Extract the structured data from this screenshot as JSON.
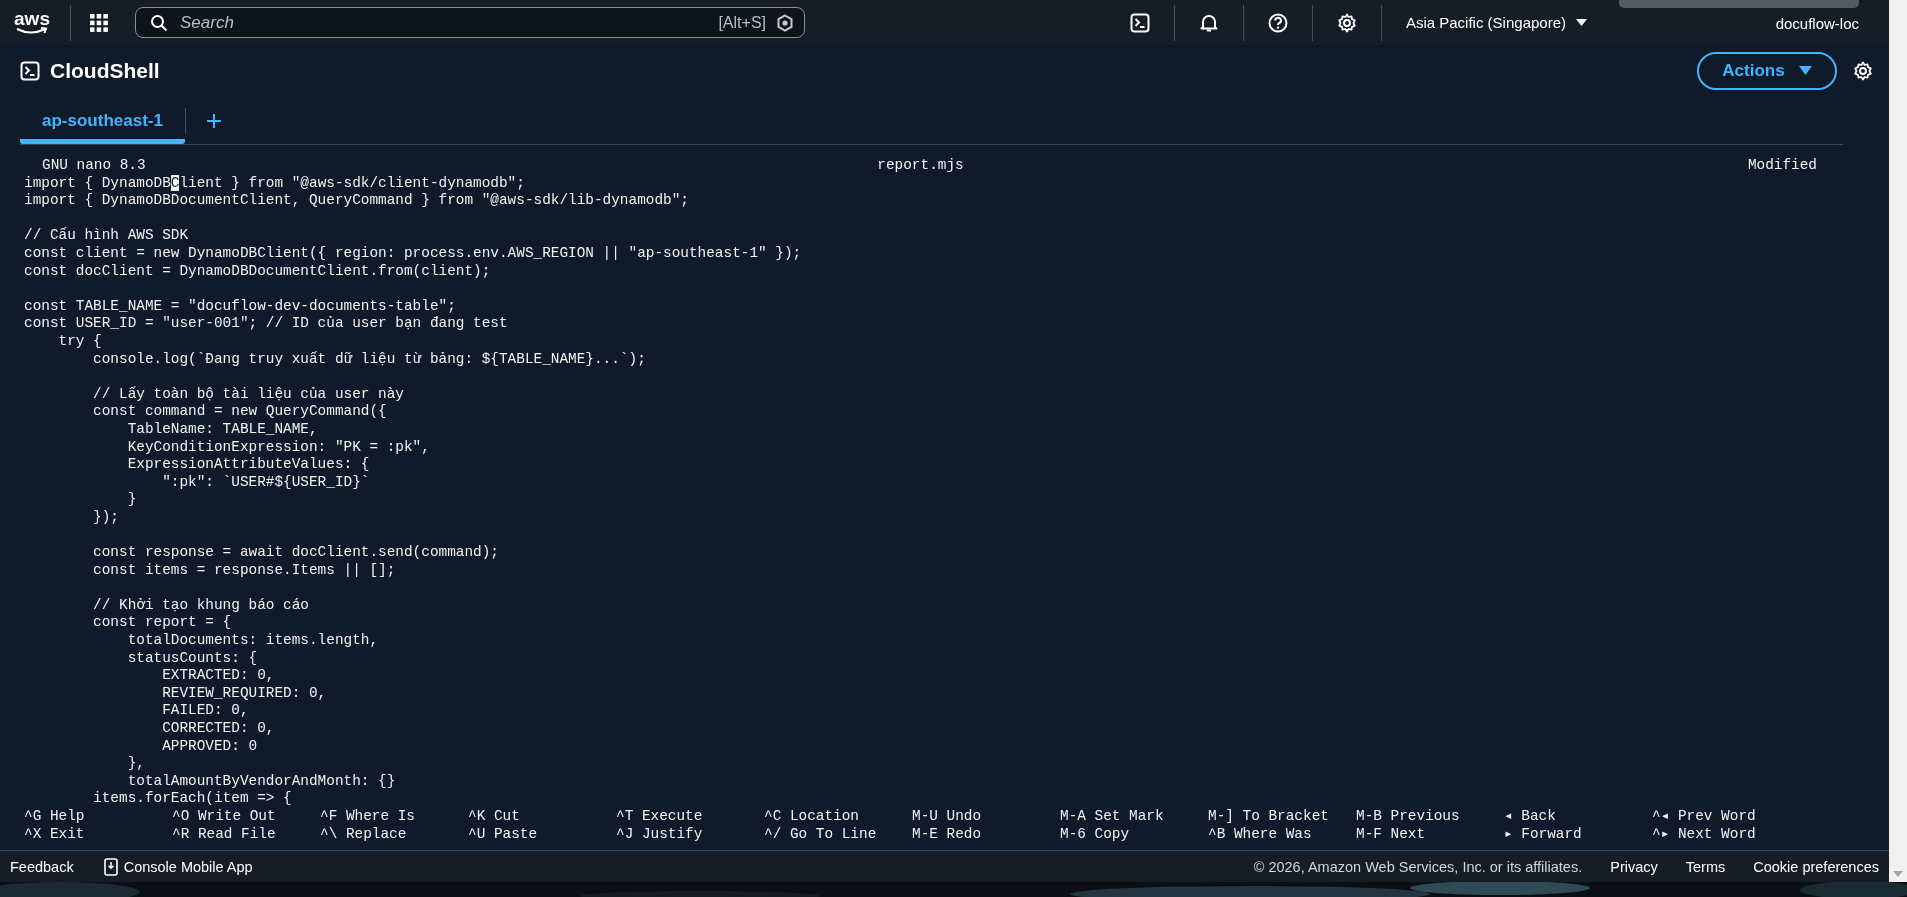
{
  "top_nav": {
    "logo": "aws",
    "search": {
      "placeholder": "Search",
      "shortcut": "[Alt+S]"
    },
    "region": "Asia Pacific (Singapore)",
    "account": "docuflow-loc"
  },
  "page": {
    "title": "CloudShell",
    "actions": "Actions"
  },
  "tabs": [
    {
      "label": "ap-southeast-1",
      "selected": true
    }
  ],
  "editor": {
    "app": "GNU nano 8.3",
    "file": "report.mjs",
    "status": "Modified",
    "lines": [
      {
        "kind": "cursor",
        "before": "import { DynamoDB",
        "cursor": "C",
        "after": "lient } from \"@aws-sdk/client-dynamodb\";"
      },
      {
        "kind": "code",
        "text": "import { DynamoDBDocumentClient, QueryCommand } from \"@aws-sdk/lib-dynamodb\";"
      },
      {
        "kind": "blank"
      },
      {
        "kind": "code",
        "text": "// Cấu hình AWS SDK"
      },
      {
        "kind": "code",
        "text": "const client = new DynamoDBClient({ region: process.env.AWS_REGION || \"ap-southeast-1\" });"
      },
      {
        "kind": "code",
        "text": "const docClient = DynamoDBDocumentClient.from(client);"
      },
      {
        "kind": "blank"
      },
      {
        "kind": "code",
        "text": "const TABLE_NAME = \"docuflow-dev-documents-table\";"
      },
      {
        "kind": "code",
        "text": "const USER_ID = \"user-001\"; // ID của user bạn đang test"
      },
      {
        "kind": "code",
        "text": "    try {"
      },
      {
        "kind": "code",
        "text": "        console.log(`Đang truy xuất dữ liệu từ bảng: ${TABLE_NAME}...`);"
      },
      {
        "kind": "blank"
      },
      {
        "kind": "code",
        "text": "        // Lấy toàn bộ tài liệu của user này"
      },
      {
        "kind": "code",
        "text": "        const command = new QueryCommand({"
      },
      {
        "kind": "code",
        "text": "            TableName: TABLE_NAME,"
      },
      {
        "kind": "code",
        "text": "            KeyConditionExpression: \"PK = :pk\","
      },
      {
        "kind": "code",
        "text": "            ExpressionAttributeValues: {"
      },
      {
        "kind": "code",
        "text": "                \":pk\": `USER#${USER_ID}`"
      },
      {
        "kind": "code",
        "text": "            }"
      },
      {
        "kind": "code",
        "text": "        });"
      },
      {
        "kind": "blank"
      },
      {
        "kind": "code",
        "text": "        const response = await docClient.send(command);"
      },
      {
        "kind": "code",
        "text": "        const items = response.Items || [];"
      },
      {
        "kind": "blank"
      },
      {
        "kind": "code",
        "text": "        // Khởi tạo khung báo cáo"
      },
      {
        "kind": "code",
        "text": "        const report = {"
      },
      {
        "kind": "code",
        "text": "            totalDocuments: items.length,"
      },
      {
        "kind": "code",
        "text": "            statusCounts: {"
      },
      {
        "kind": "code",
        "text": "                EXTRACTED: 0,"
      },
      {
        "kind": "code",
        "text": "                REVIEW_REQUIRED: 0,"
      },
      {
        "kind": "code",
        "text": "                FAILED: 0,"
      },
      {
        "kind": "code",
        "text": "                CORRECTED: 0,"
      },
      {
        "kind": "code",
        "text": "                APPROVED: 0"
      },
      {
        "kind": "code",
        "text": "            },"
      },
      {
        "kind": "code",
        "text": "            totalAmountByVendorAndMonth: {}"
      },
      {
        "kind": "code",
        "text": "        items.forEach(item => {"
      }
    ],
    "shortcuts": [
      [
        "^G Help",
        "^O Write Out",
        "^F Where Is",
        "^K Cut",
        "^T Execute",
        "^C Location",
        "M-U Undo",
        "M-A Set Mark",
        "M-] To Bracket",
        "M-B Previous",
        "◂ Back",
        "^◂ Prev Word"
      ],
      [
        "^X Exit",
        "^R Read File",
        "^\\ Replace",
        "^U Paste",
        "^J Justify",
        "^/ Go To Line",
        "M-E Redo",
        "M-6 Copy",
        "^B Where Was",
        "M-F Next",
        "▸ Forward",
        "^▸ Next Word"
      ]
    ]
  },
  "footer": {
    "feedback": "Feedback",
    "mobile_app": "Console Mobile App",
    "copyright": "© 2026, Amazon Web Services, Inc. or its affiliates.",
    "links": [
      "Privacy",
      "Terms",
      "Cookie preferences"
    ]
  }
}
